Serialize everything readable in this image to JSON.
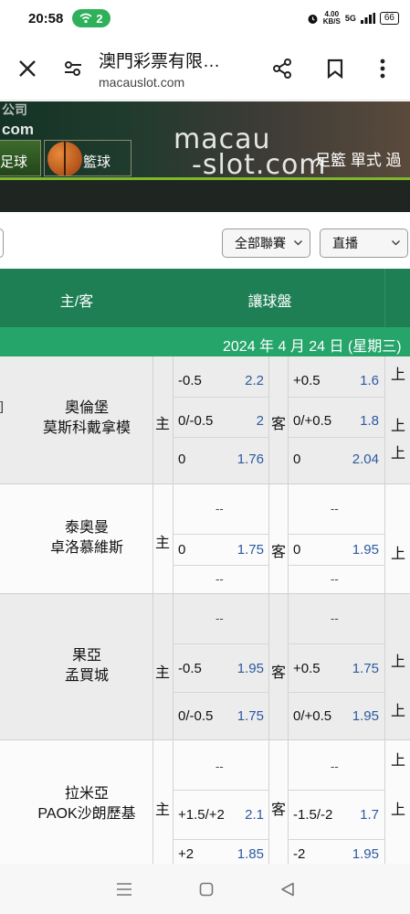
{
  "status_bar": {
    "time": "20:58",
    "hotspot_count": "2",
    "net_speed_top": "4.00",
    "net_speed_bottom": "KB/S",
    "network": "5G",
    "battery": "66"
  },
  "browser": {
    "title": "澳門彩票有限…",
    "url": "macauslot.com"
  },
  "banner": {
    "logo_line1": "公司",
    "logo_line2": "com",
    "tab_football": "足球",
    "tab_basketball": "籃球",
    "brand_line1": "macau",
    "brand_line2": "-slot.com",
    "menu_text": "足籃 單式 過"
  },
  "filters": {
    "league": "全部聯賽",
    "mode": "直播"
  },
  "table": {
    "col_teams": "主/客",
    "col_handicap": "讓球盤",
    "date": "2024 年 4 月 24 日 (星期三)"
  },
  "labels": {
    "home": "主",
    "away": "客",
    "over": "上"
  },
  "matches": [
    {
      "home": "奧倫堡",
      "away": "莫斯科戴拿模",
      "edge": "]",
      "rows": [
        {
          "h_line": "-0.5",
          "h_odd": "2.2",
          "a_line": "+0.5",
          "a_odd": "1.6"
        },
        {
          "h_line": "0/-0.5",
          "h_odd": "2",
          "a_line": "0/+0.5",
          "a_odd": "1.8"
        },
        {
          "h_line": "0",
          "h_odd": "1.76",
          "a_line": "0",
          "a_odd": "2.04"
        }
      ]
    },
    {
      "home": "泰奧曼",
      "away": "卓洛慕維斯",
      "dash": "--",
      "rows": [
        {
          "h_line": "0",
          "h_odd": "1.75",
          "a_line": "0",
          "a_odd": "1.95"
        }
      ]
    },
    {
      "home": "果亞",
      "away": "孟買城",
      "rows": [
        {
          "h_line": "-0.5",
          "h_odd": "1.95",
          "a_line": "+0.5",
          "a_odd": "1.75"
        },
        {
          "h_line": "0/-0.5",
          "h_odd": "1.75",
          "a_line": "0/+0.5",
          "a_odd": "1.95"
        }
      ]
    },
    {
      "home": "拉米亞",
      "away": "PAOK沙朗歷基",
      "rows": [
        {
          "h_line": "+1.5/+2",
          "h_odd": "2.1",
          "a_line": "-1.5/-2",
          "a_odd": "1.7"
        },
        {
          "h_line": "+2",
          "h_odd": "1.85",
          "a_line": "-2",
          "a_odd": "1.95"
        }
      ]
    }
  ]
}
